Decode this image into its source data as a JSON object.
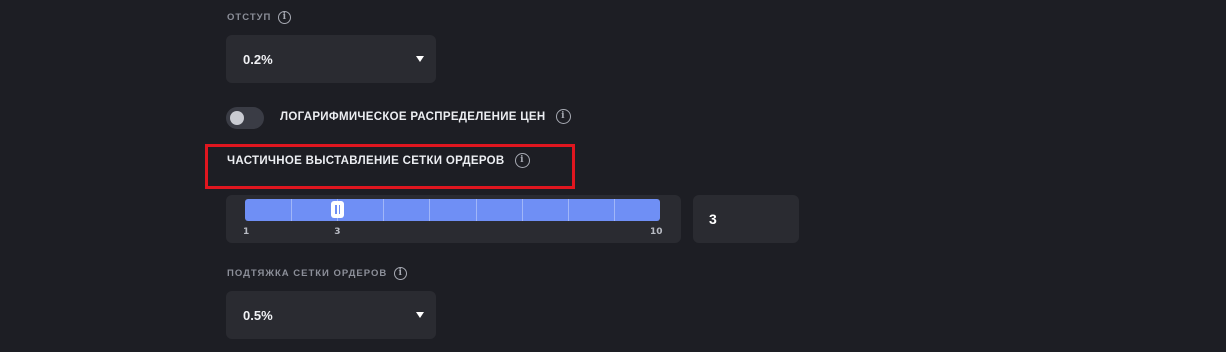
{
  "indent": {
    "label": "ОТСТУП",
    "value": "0.2%"
  },
  "log_distribution": {
    "label": "ЛОГАРИФМИЧЕСКОЕ РАСПРЕДЕЛЕНИЕ ЦЕН",
    "enabled": false
  },
  "partial_grid": {
    "label": "ЧАСТИЧНОЕ ВЫСТАВЛЕНИЕ СЕТКИ ОРДЕРОВ",
    "highlight_color": "#e0161f",
    "slider": {
      "min": 1,
      "max": 10,
      "value": 3,
      "min_label": "1",
      "max_label": "10",
      "value_label": "3",
      "track_color": "#6f8ff5"
    },
    "input_value": "3"
  },
  "grid_pullup": {
    "label": "ПОДТЯЖКА СЕТКИ ОРДЕРОВ",
    "value": "0.5%"
  },
  "icons": {
    "info": "info-icon",
    "caret": "caret-down-icon"
  }
}
